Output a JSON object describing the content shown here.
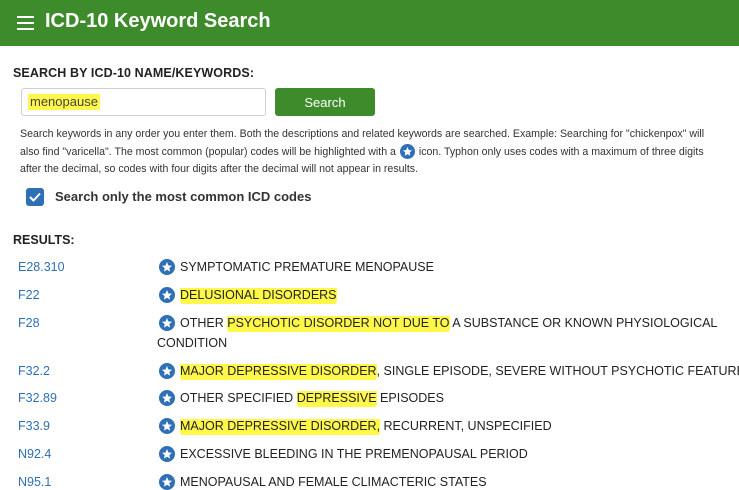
{
  "header": {
    "title": "ICD-10 Keyword Search",
    "menu_icon": "hamburger-menu-icon",
    "background": "#3d8b2a"
  },
  "search": {
    "label": "SEARCH BY ICD-10 NAME/KEYWORDS:",
    "value": "menopause",
    "button_label": "Search",
    "help_lines": [
      "Search keywords in any order you enter them.  Both the descriptions and related keywords are searched.  Example: Searching for \"chickenpox\" will",
      "also find \"varicella\".  The most common (popular) codes will be highlighted with a",
      "icon.  Typhon only uses codes with a maximum of three digits",
      "after the decimal, so codes with four digits after the decimal will not appear in results."
    ],
    "common_only": {
      "label": "Search only the most common ICD codes",
      "checked": true
    }
  },
  "results": {
    "label": "RESULTS:",
    "items": [
      {
        "code": "E28.310",
        "common": true,
        "pre": "SYMPTOMATIC PREMATURE MENOPAUSE",
        "hl": "",
        "post": "",
        "line2": ""
      },
      {
        "code": "F22",
        "common": true,
        "pre": "",
        "hl": "DELUSIONAL DISORDERS",
        "post": "",
        "line2": ""
      },
      {
        "code": "F28",
        "common": true,
        "pre": "OTHER ",
        "hl": "PSYCHOTIC DISORDER NOT DUE TO",
        "post": " A SUBSTANCE OR KNOWN PHYSIOLOGICAL",
        "line2": "CONDITION"
      },
      {
        "code": "F32.2",
        "common": true,
        "pre": "",
        "hl": "MAJOR DEPRESSIVE DISORDER",
        "post": ", SINGLE EPISODE, SEVERE WITHOUT PSYCHOTIC FEATURES",
        "line2": ""
      },
      {
        "code": "F32.89",
        "common": true,
        "pre": "OTHER SPECIFIED ",
        "hl": "DEPRESSIVE",
        "post": " EPISODES",
        "line2": ""
      },
      {
        "code": "F33.9",
        "common": true,
        "pre": "",
        "hl": "MAJOR DEPRESSIVE DISORDER,",
        "post": " RECURRENT, UNSPECIFIED",
        "line2": ""
      },
      {
        "code": "N92.4",
        "common": true,
        "pre": "EXCESSIVE BLEEDING IN THE PREMENOPAUSAL PERIOD",
        "hl": "",
        "post": "",
        "line2": ""
      },
      {
        "code": "N95.1",
        "common": true,
        "pre": "MENOPAUSAL AND FEMALE CLIMACTERIC STATES",
        "hl": "",
        "post": "",
        "line2": ""
      }
    ]
  },
  "colors": {
    "accent": "#3d8b2a",
    "link": "#2f6fb5",
    "highlight": "#fff84a"
  },
  "icons": {
    "common_code": "star-badge-icon",
    "checkbox": "checkmark-icon"
  }
}
